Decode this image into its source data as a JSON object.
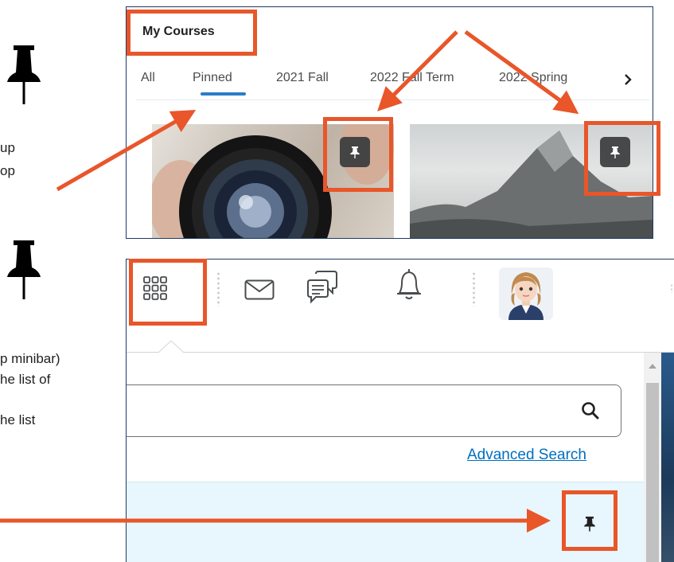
{
  "left_notes": {
    "line1": "up",
    "line2": "op",
    "line3": "p minibar)",
    "line4": "he list of",
    "line5": "he list"
  },
  "courses_panel": {
    "title": "My Courses",
    "tabs": [
      "All",
      "Pinned",
      "2021 Fall",
      "2022 Fall Term",
      "2022 Spring"
    ],
    "active_tab": "Pinned",
    "next_icon": "chevron-right-icon",
    "cards": [
      {
        "image": "camera-lens",
        "pin_icon": "pin-icon"
      },
      {
        "image": "mountain",
        "pin_icon": "pin-icon"
      }
    ]
  },
  "minibar_panel": {
    "icons": [
      "course-selector-grid-icon",
      "mail-icon",
      "messages-icon",
      "notifications-bell-icon",
      "user-avatar"
    ],
    "search": {
      "placeholder": "",
      "value": "",
      "icon": "search-icon"
    },
    "advanced_search_label": "Advanced Search",
    "list_item_pin_icon": "pin-icon"
  },
  "colors": {
    "highlight": "#e8562a",
    "panel_border": "#1f3a64",
    "link": "#006fbf",
    "active_tab_underline": "#2d7cc9",
    "selected_row": "#e8f6fd"
  }
}
